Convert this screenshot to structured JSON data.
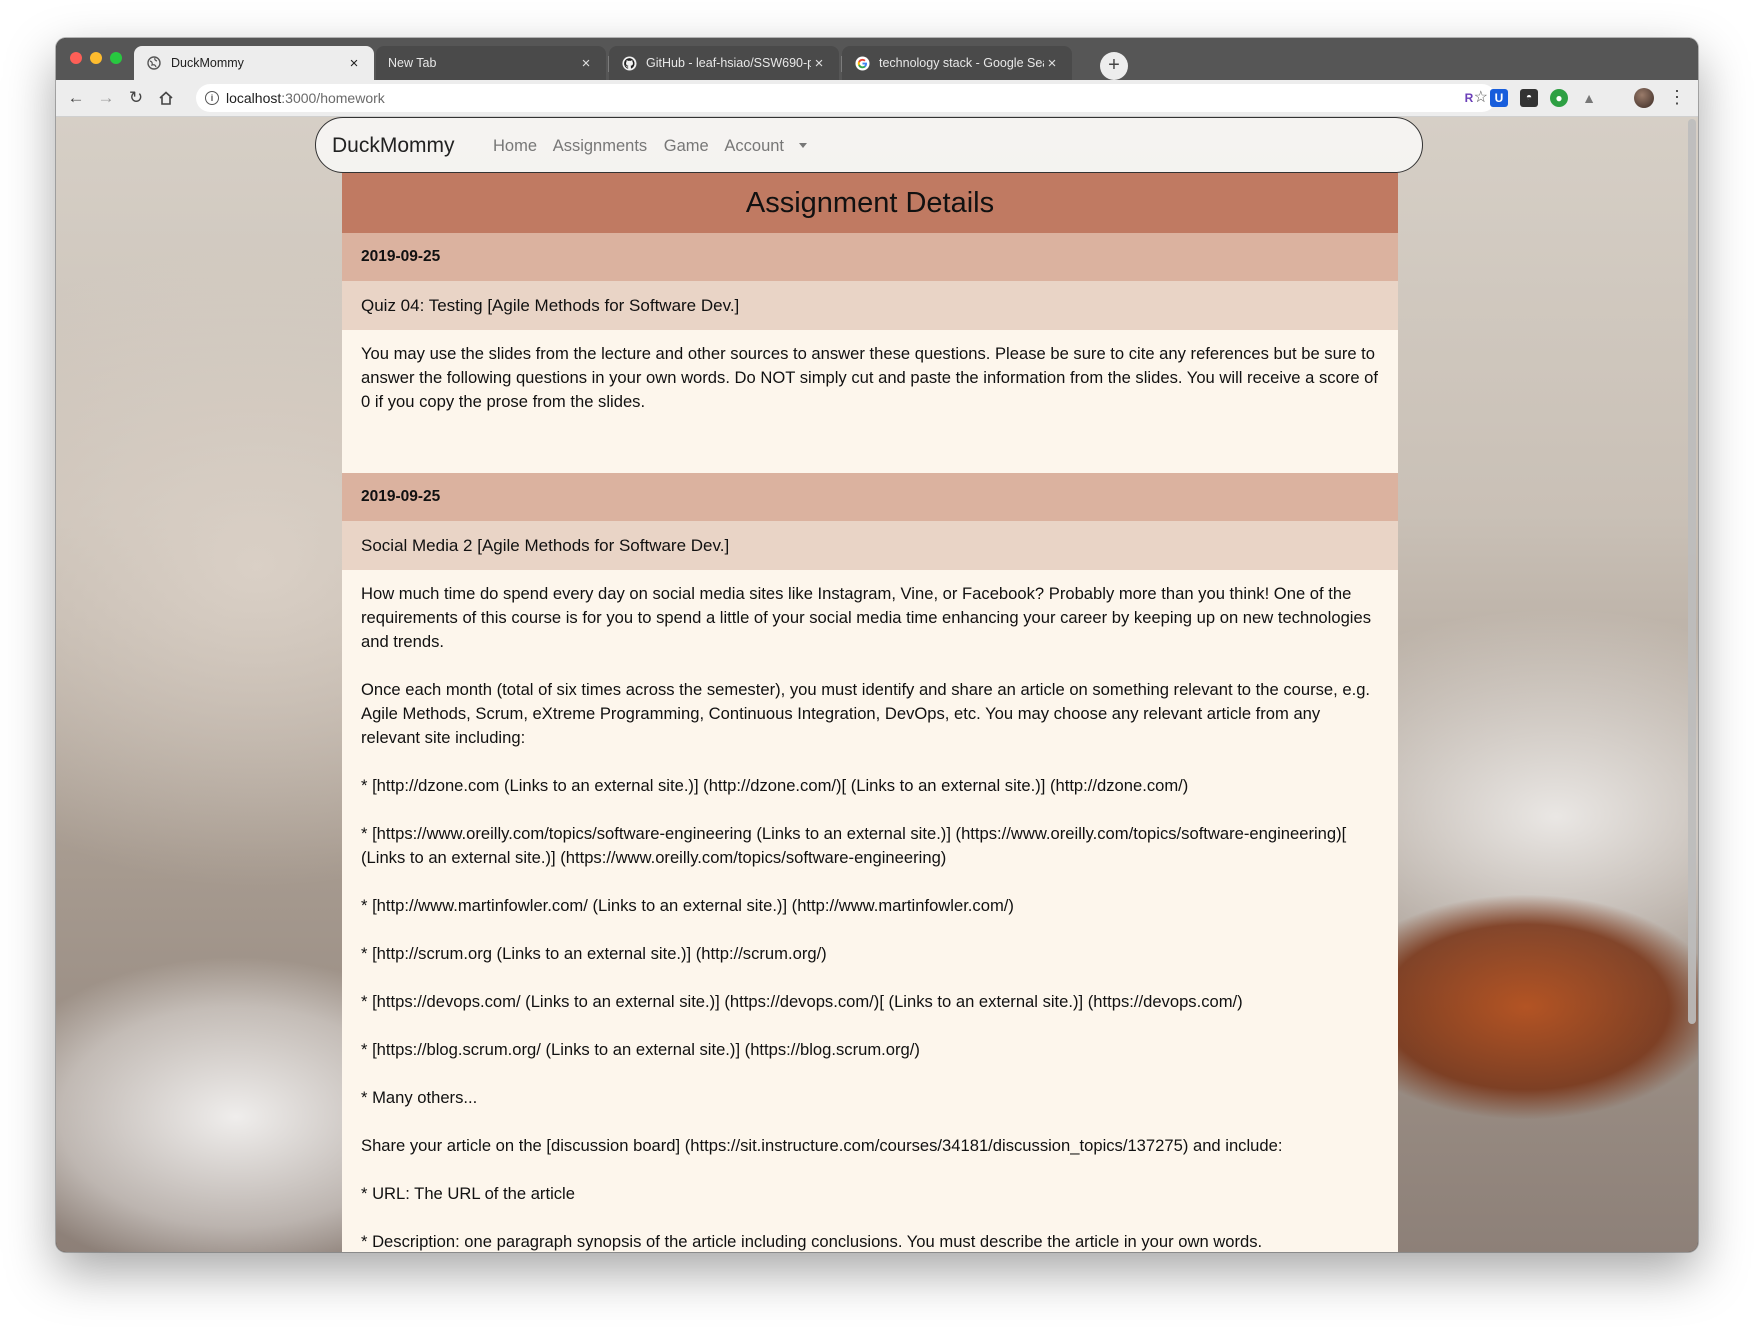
{
  "browser": {
    "tabs": [
      {
        "title": "DuckMommy",
        "active": true,
        "icon": "globe-icon"
      },
      {
        "title": "New Tab",
        "active": false,
        "icon": ""
      },
      {
        "title": "GitHub - leaf-hsiao/SSW690-p",
        "active": false,
        "icon": "github-icon"
      },
      {
        "title": "technology stack - Google Sea",
        "active": false,
        "icon": "google-icon"
      }
    ],
    "url_host": "localhost",
    "url_path": ":3000/homework"
  },
  "nav": {
    "brand": "DuckMommy",
    "home": "Home",
    "assignments": "Assignments",
    "game": "Game",
    "account": "Account"
  },
  "page": {
    "title": "Assignment Details"
  },
  "assignments": [
    {
      "date": "2019-09-25",
      "title": "Quiz 04: Testing [Agile Methods for Software Dev.]",
      "paragraphs": [
        "You may use the slides from the lecture and other sources to answer these questions.   Please be sure to cite any references but be sure to answer the following questions in your own words.  Do NOT simply cut and paste the information from the slides.   You will receive a score of 0 if you copy the prose from the slides."
      ]
    },
    {
      "date": "2019-09-25",
      "title": "Social Media 2 [Agile Methods for Software Dev.]",
      "paragraphs": [
        "How much time do spend every day on social media sites like Instagram, Vine, or Facebook?  Probably more than you think!  One of the requirements of this course is for you to spend a little of your social media time enhancing your career by keeping up on new technologies and trends.",
        "Once each month (total of six times across the semester), you must identify and share an article on something relevant to the course, e.g. Agile Methods, Scrum, eXtreme Programming, Continuous Integration, DevOps, etc.  You may choose any relevant article from any relevant site including:",
        "* [http://dzone.com (Links to an external site.)] (http://dzone.com/)[ (Links to an external site.)] (http://dzone.com/)",
        "* [https://www.oreilly.com/topics/software-engineering (Links to an external site.)] (https://www.oreilly.com/topics/software-engineering)[ (Links to an external site.)] (https://www.oreilly.com/topics/software-engineering)",
        "* [http://www.martinfowler.com/ (Links to an external site.)] (http://www.martinfowler.com/)",
        "* [http://scrum.org (Links to an external site.)] (http://scrum.org/)",
        "* [https://devops.com/ (Links to an external site.)] (https://devops.com/)[ (Links to an external site.)] (https://devops.com/)",
        "* [https://blog.scrum.org/ (Links to an external site.)] (https://blog.scrum.org/)",
        "* Many others...",
        "Share your article on the [discussion board] (https://sit.instructure.com/courses/34181/discussion_topics/137275) and include:",
        "* URL: The URL of the article",
        "* Description: one paragraph synopsis of the article including conclusions. You must describe the article in your own words."
      ]
    }
  ],
  "colors": {
    "header": "#c07a62",
    "date_row": "#dbb29f",
    "title_row": "#e9d4c6",
    "body": "#fdf6ec"
  }
}
